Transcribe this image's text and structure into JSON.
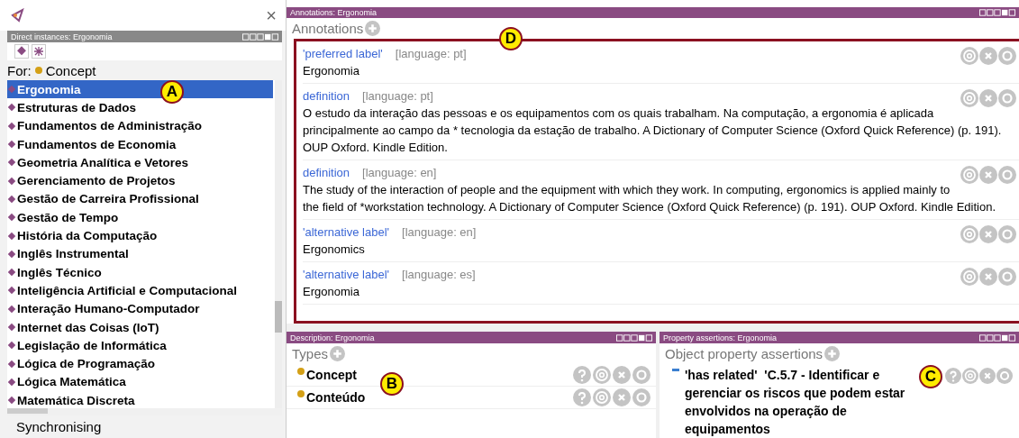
{
  "left": {
    "close": "×",
    "panel_title": "Direct instances: Ergonomia",
    "for_label": "For:",
    "for_class": "Concept",
    "callout": "A",
    "items": [
      {
        "label": "Ergonomia",
        "selected": true
      },
      {
        "label": "Estruturas de Dados",
        "selected": false
      },
      {
        "label": "Fundamentos de Administração",
        "selected": false
      },
      {
        "label": "Fundamentos de Economia",
        "selected": false
      },
      {
        "label": "Geometria Analítica e Vetores",
        "selected": false
      },
      {
        "label": "Gerenciamento de Projetos",
        "selected": false
      },
      {
        "label": "Gestão de Carreira Profissional",
        "selected": false
      },
      {
        "label": "Gestão de Tempo",
        "selected": false
      },
      {
        "label": "História da Computação",
        "selected": false
      },
      {
        "label": "Inglês Instrumental",
        "selected": false
      },
      {
        "label": "Inglês Técnico",
        "selected": false
      },
      {
        "label": "Inteligência Artificial e Computacional",
        "selected": false
      },
      {
        "label": "Interação Humano-Computador",
        "selected": false
      },
      {
        "label": "Internet das Coisas (IoT)",
        "selected": false
      },
      {
        "label": "Legislação de Informática",
        "selected": false
      },
      {
        "label": "Lógica de Programação",
        "selected": false
      },
      {
        "label": "Lógica Matemática",
        "selected": false
      },
      {
        "label": "Matemática Discreta",
        "selected": false
      }
    ],
    "status": "Synchronising"
  },
  "annotations": {
    "panel_title": "Annotations: Ergonomia",
    "header": "Annotations",
    "callout": "D",
    "items": [
      {
        "property": "'preferred label'",
        "language": "[language: pt]",
        "value": "Ergonomia"
      },
      {
        "property": "definition",
        "language": "[language: pt]",
        "value": "O estudo da interação das pessoas e os equipamentos com os quais trabalham. Na computação, a ergonomia é aplicada principalmente ao campo da * tecnologia da estação de trabalho. A Dictionary of Computer Science (Oxford Quick Reference) (p. 191). OUP Oxford. Kindle Edition."
      },
      {
        "property": "definition",
        "language": "[language: en]",
        "value": "The study of the interaction of people and the equipment with which they work. In computing, ergonomics is applied mainly to the field of *workstation technology. A Dictionary of Computer Science (Oxford Quick Reference) (p. 191). OUP Oxford. Kindle Edition."
      },
      {
        "property": "'alternative label'",
        "language": "[language: en]",
        "value": "Ergonomics"
      },
      {
        "property": "'alternative label'",
        "language": "[language: es]",
        "value": "Ergonomia"
      }
    ]
  },
  "description": {
    "panel_title": "Description: Ergonomia",
    "header": "Types",
    "callout": "B",
    "types": [
      "Concept",
      "Conteúdo"
    ]
  },
  "property_assertions": {
    "panel_title": "Property assertions: Ergonomia",
    "header": "Object property assertions",
    "callout": "C",
    "assertions": [
      "'has related'  'C.5.7 - Identificar e gerenciar os riscos que podem estar envolvidos na operação de equipamentos"
    ]
  }
}
